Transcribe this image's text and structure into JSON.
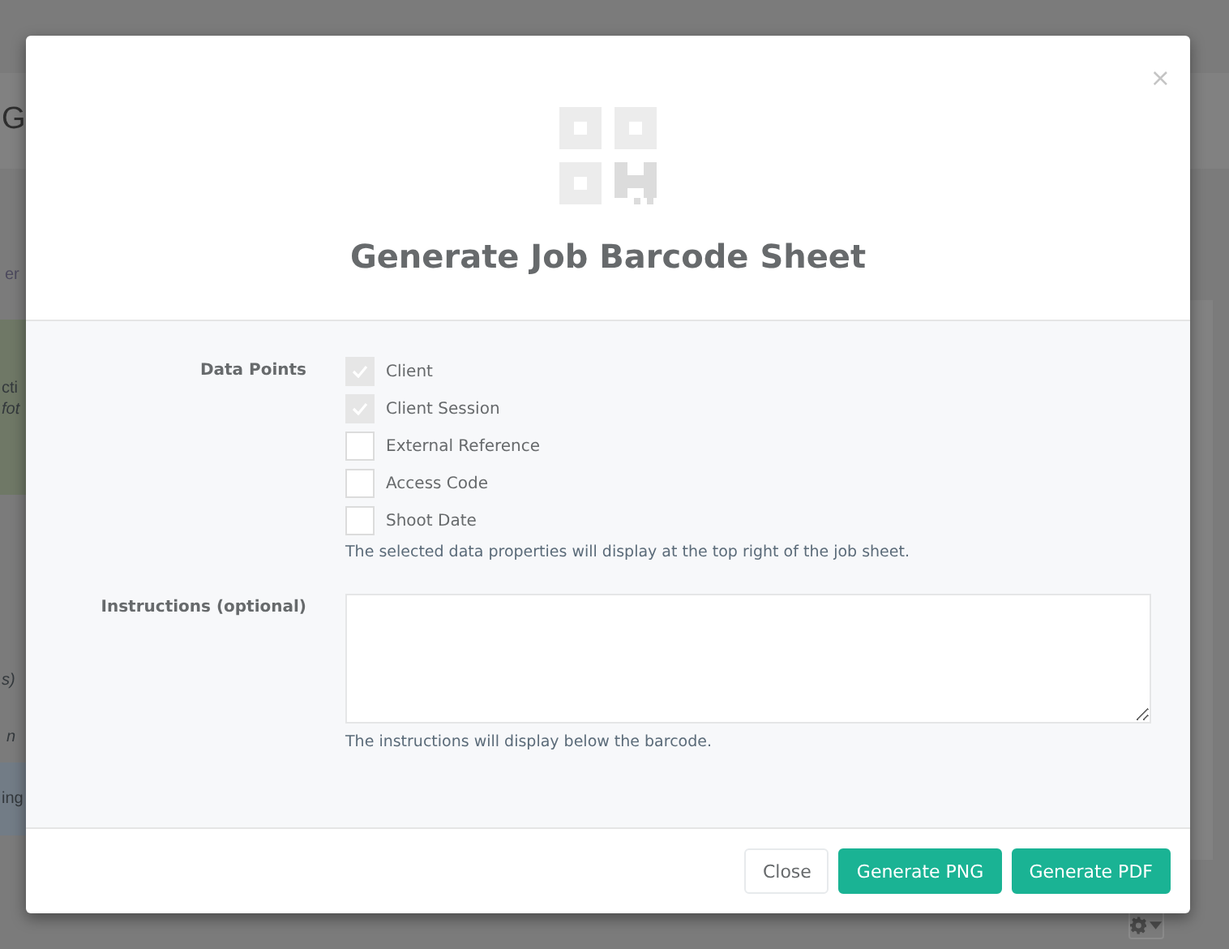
{
  "background": {
    "fragments": [
      {
        "text": "G",
        "kind": "heading"
      },
      {
        "text": "er",
        "kind": "link"
      },
      {
        "text": "cti",
        "kind": "plain"
      },
      {
        "text": "fot",
        "kind": "italic"
      },
      {
        "text": "s)",
        "kind": "italic"
      },
      {
        "text": "n",
        "kind": "italic"
      },
      {
        "text": "ing",
        "kind": "plain"
      }
    ]
  },
  "dialog": {
    "title": "Generate Job Barcode Sheet",
    "close": "×",
    "data_points": {
      "label": "Data Points",
      "help": "The selected data properties will display at the top right of the job sheet.",
      "options": [
        {
          "label": "Client",
          "checked": true
        },
        {
          "label": "Client Session",
          "checked": true
        },
        {
          "label": "External Reference",
          "checked": false
        },
        {
          "label": "Access Code",
          "checked": false
        },
        {
          "label": "Shoot Date",
          "checked": false
        }
      ]
    },
    "instructions": {
      "label": "Instructions (optional)",
      "help": "The instructions will display below the barcode."
    },
    "buttons": [
      {
        "label": "Close",
        "kind": "default"
      },
      {
        "label": "Generate PNG",
        "kind": "primary"
      },
      {
        "label": "Generate PDF",
        "kind": "primary"
      }
    ]
  }
}
